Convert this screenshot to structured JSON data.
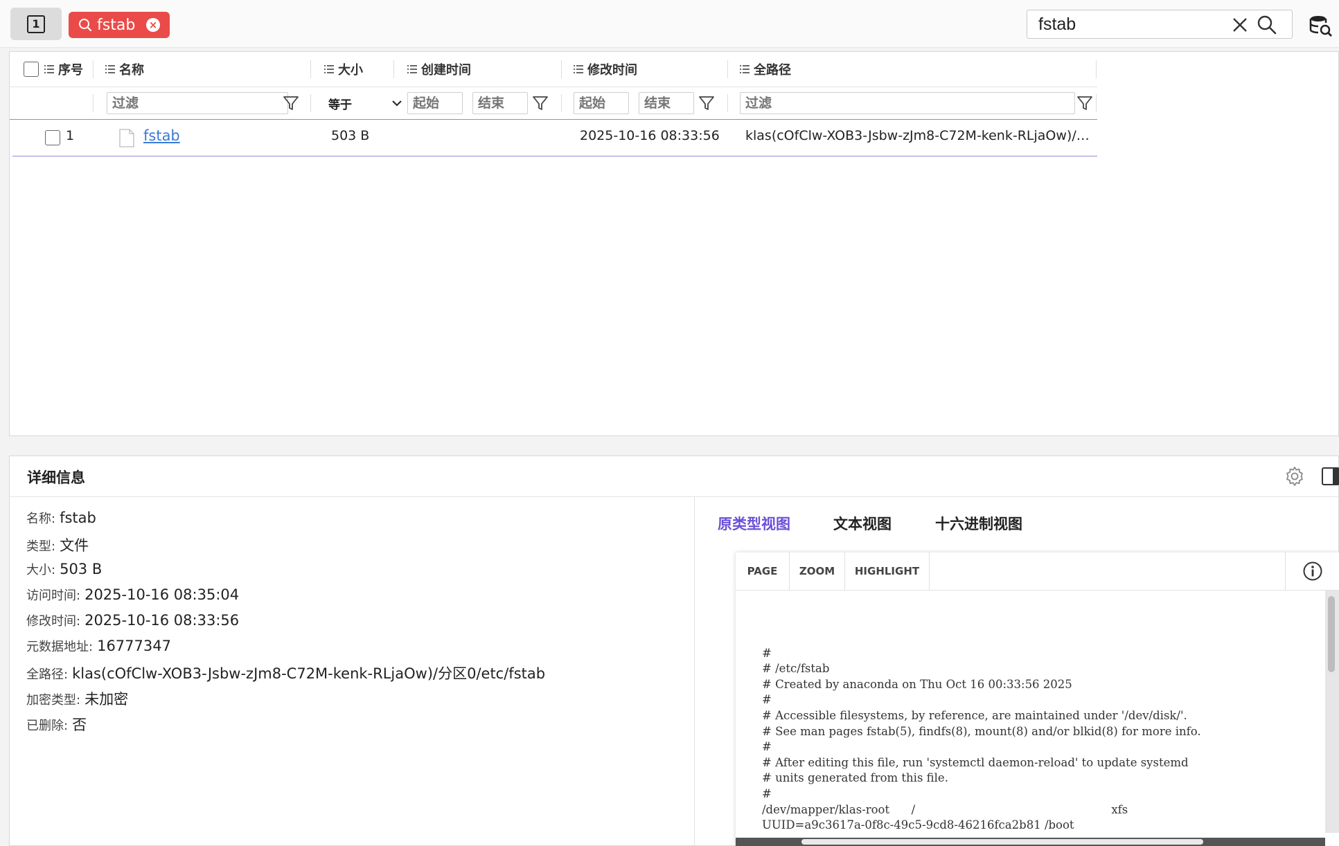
{
  "toolbar": {
    "tab_toggle_label": "1",
    "search_tag": {
      "label": "fstab",
      "close": "×"
    },
    "search_input": {
      "value": "fstab"
    }
  },
  "table": {
    "columns": {
      "index": "序号",
      "name": "名称",
      "size": "大小",
      "created": "创建时间",
      "modified": "修改时间",
      "fullpath": "全路径"
    },
    "filters": {
      "name_placeholder": "过滤",
      "size_op": "等于",
      "created_start": "起始",
      "created_end": "结束",
      "modified_start": "起始",
      "modified_end": "结束",
      "path_placeholder": "过滤"
    },
    "rows": [
      {
        "index": "1",
        "name": "fstab",
        "size": "503 B",
        "created": "",
        "modified": "2025-10-16 08:33:56",
        "fullpath": "klas(cOfClw-XOB3-Jsbw-zJm8-C72M-kenk-RLjaOw)/…"
      }
    ]
  },
  "details": {
    "title": "详细信息",
    "fields": [
      {
        "label": "名称:",
        "value": "fstab"
      },
      {
        "label": "类型:",
        "value": "文件"
      },
      {
        "label": "大小:",
        "value": "503 B"
      },
      {
        "label": "访问时间:",
        "value": "2025-10-16 08:35:04"
      },
      {
        "label": "修改时间:",
        "value": "2025-10-16 08:33:56"
      },
      {
        "label": "元数据地址:",
        "value": "16777347"
      },
      {
        "label": "全路径:",
        "value": "klas(cOfClw-XOB3-Jsbw-zJm8-C72M-kenk-RLjaOw)/分区0/etc/fstab"
      },
      {
        "label": "加密类型:",
        "value": "未加密"
      },
      {
        "label": "已删除:",
        "value": "否"
      }
    ],
    "view_tabs": [
      {
        "label": "原类型视图",
        "active": true
      },
      {
        "label": "文本视图",
        "active": false
      },
      {
        "label": "十六进制视图",
        "active": false
      }
    ],
    "viewer": {
      "buttons": [
        "PAGE",
        "ZOOM",
        "HIGHLIGHT"
      ],
      "content_lines": [
        "",
        "#",
        "# /etc/fstab",
        "# Created by anaconda on Thu Oct 16 00:33:56 2025",
        "#",
        "# Accessible filesystems, by reference, are maintained under '/dev/disk/'.",
        "# See man pages fstab(5), findfs(8), mount(8) and/or blkid(8) for more info.",
        "#",
        "# After editing this file, run 'systemctl daemon-reload' to update systemd",
        "# units generated from this file.",
        "#",
        "/dev/mapper/klas-root      /                                                      xfs",
        "UUID=a9c3617a-0f8c-49c5-9cd8-46216fca2b81 /boot"
      ]
    }
  },
  "colors": {
    "accent_red": "#ea4b48",
    "accent_purple": "#6b4fd8",
    "row_underline": "#8e8bd6",
    "link_blue": "#3a7bd5"
  }
}
